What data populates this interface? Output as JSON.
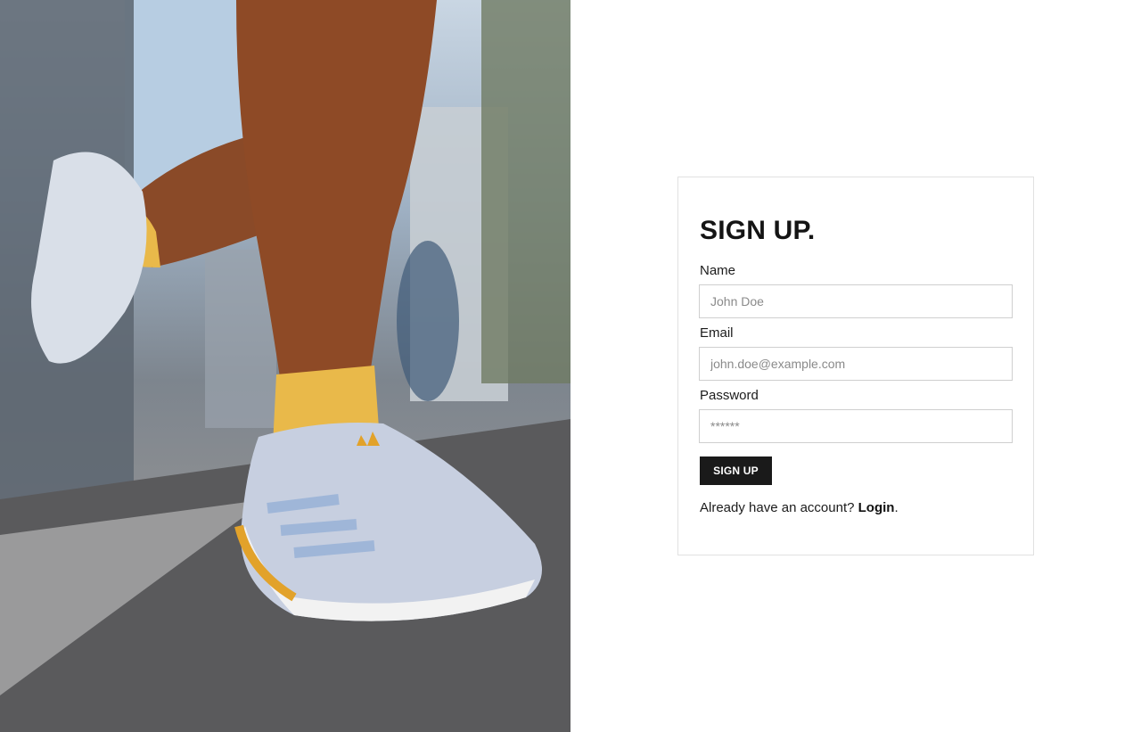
{
  "hero": {
    "image": "running-shoe-photo"
  },
  "signup": {
    "title": "SIGN UP.",
    "fields": [
      {
        "label": "Name",
        "placeholder": "John Doe",
        "value": ""
      },
      {
        "label": "Email",
        "placeholder": "john.doe@example.com",
        "value": ""
      },
      {
        "label": "Password",
        "placeholder": "******",
        "value": ""
      }
    ],
    "submit_label": "SIGN UP",
    "footer_text": "Already have an account? ",
    "login_link": "Login",
    "footer_period": "."
  },
  "colors": {
    "button_bg": "#1a1a1a",
    "button_text": "#ffffff",
    "card_border": "#e1e1e1",
    "input_border": "#cfcfcf"
  }
}
